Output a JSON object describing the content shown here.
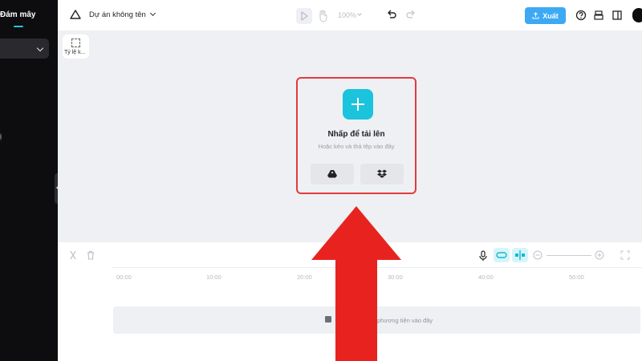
{
  "sidebar": {
    "title": "Đám mây",
    "fragment": "ị"
  },
  "header": {
    "project_name": "Dự án không tên",
    "zoom": "100%",
    "export_label": "Xuất"
  },
  "canvas": {
    "ratio_label": "Tỷ lệ k..."
  },
  "upload": {
    "title": "Nhấp để tải lên",
    "hint": "Hoặc kéo và thả tệp vào đây"
  },
  "timeline": {
    "ruler": [
      "00:00",
      "10:00",
      "20:00",
      "30:00",
      "40:00",
      "50:00"
    ],
    "track_hint": "phương tiện vào đây"
  },
  "colors": {
    "accent": "#1bc3dc",
    "export_button": "#3da9f5",
    "highlight_border": "#e23b3b",
    "arrow": "#e8231f"
  },
  "icons": {
    "project": "cloud-outline-icon",
    "export": "upload-icon",
    "google_drive": "google-drive-icon",
    "dropbox": "dropbox-icon"
  }
}
